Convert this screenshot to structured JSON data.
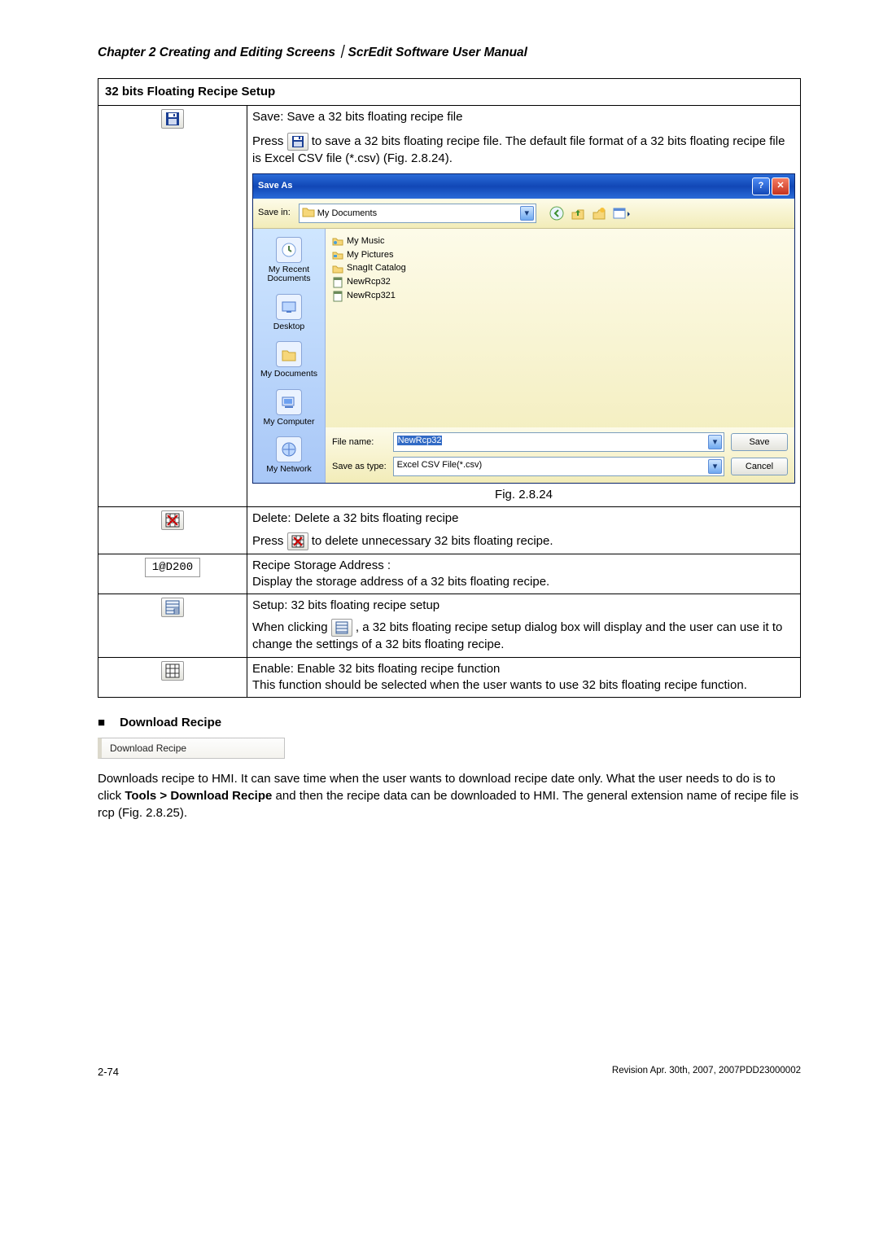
{
  "header_line": "Chapter 2  Creating and Editing Screens｜ScrEdit Software User Manual",
  "table_title": "32 bits Floating Recipe Setup",
  "save_row": {
    "line1": "Save: Save a 32 bits floating recipe file",
    "press": "Press ",
    "after_icon": " to save a 32 bits floating recipe file. The default file format of a 32 bits floating recipe file is Excel CSV file (*.csv) (Fig. 2.8.24).",
    "caption": "Fig. 2.8.24"
  },
  "dialog": {
    "title": "Save As",
    "save_in_label": "Save in:",
    "save_in_value": "My Documents",
    "places": [
      "My Recent Documents",
      "Desktop",
      "My Documents",
      "My Computer",
      "My Network"
    ],
    "files": [
      "My Music",
      "My Pictures",
      "SnagIt Catalog",
      "NewRcp32",
      "NewRcp321"
    ],
    "file_name_label": "File name:",
    "file_name_value": "NewRcp32",
    "save_as_type_label": "Save as type:",
    "save_as_type_value": "Excel CSV File(*.csv)",
    "btn_save": "Save",
    "btn_cancel": "Cancel"
  },
  "delete_row": {
    "line1": "Delete: Delete a 32 bits floating recipe",
    "press": "Press ",
    "after_icon": " to delete unnecessary 32 bits floating recipe."
  },
  "addr_row": {
    "addr": "1@D200",
    "line1": "Recipe Storage Address :",
    "line2": "Display the storage address of a 32 bits floating recipe."
  },
  "setup_row": {
    "line1": "Setup: 32 bits floating recipe setup",
    "before_icon": "When clicking ",
    "after_icon": ", a 32 bits floating recipe setup dialog box will display and the user can use it to change the settings of a 32 bits floating recipe."
  },
  "enable_row": {
    "line1": "Enable: Enable 32 bits floating recipe function",
    "line2": "This function should be selected when the user wants to use 32 bits floating recipe function."
  },
  "download": {
    "title": "Download Recipe",
    "menu_label": "Download Recipe",
    "body_before": "Downloads recipe to HMI. It can save time when the user wants to download recipe date only. What the user needs to do is to click ",
    "bold": "Tools > Download Recipe",
    "body_after": " and then the recipe data can be downloaded to HMI. The general extension name of recipe file is rcp (Fig. 2.8.25)."
  },
  "footer": {
    "left": "2-74",
    "right": "Revision Apr. 30th, 2007, 2007PDD23000002"
  }
}
